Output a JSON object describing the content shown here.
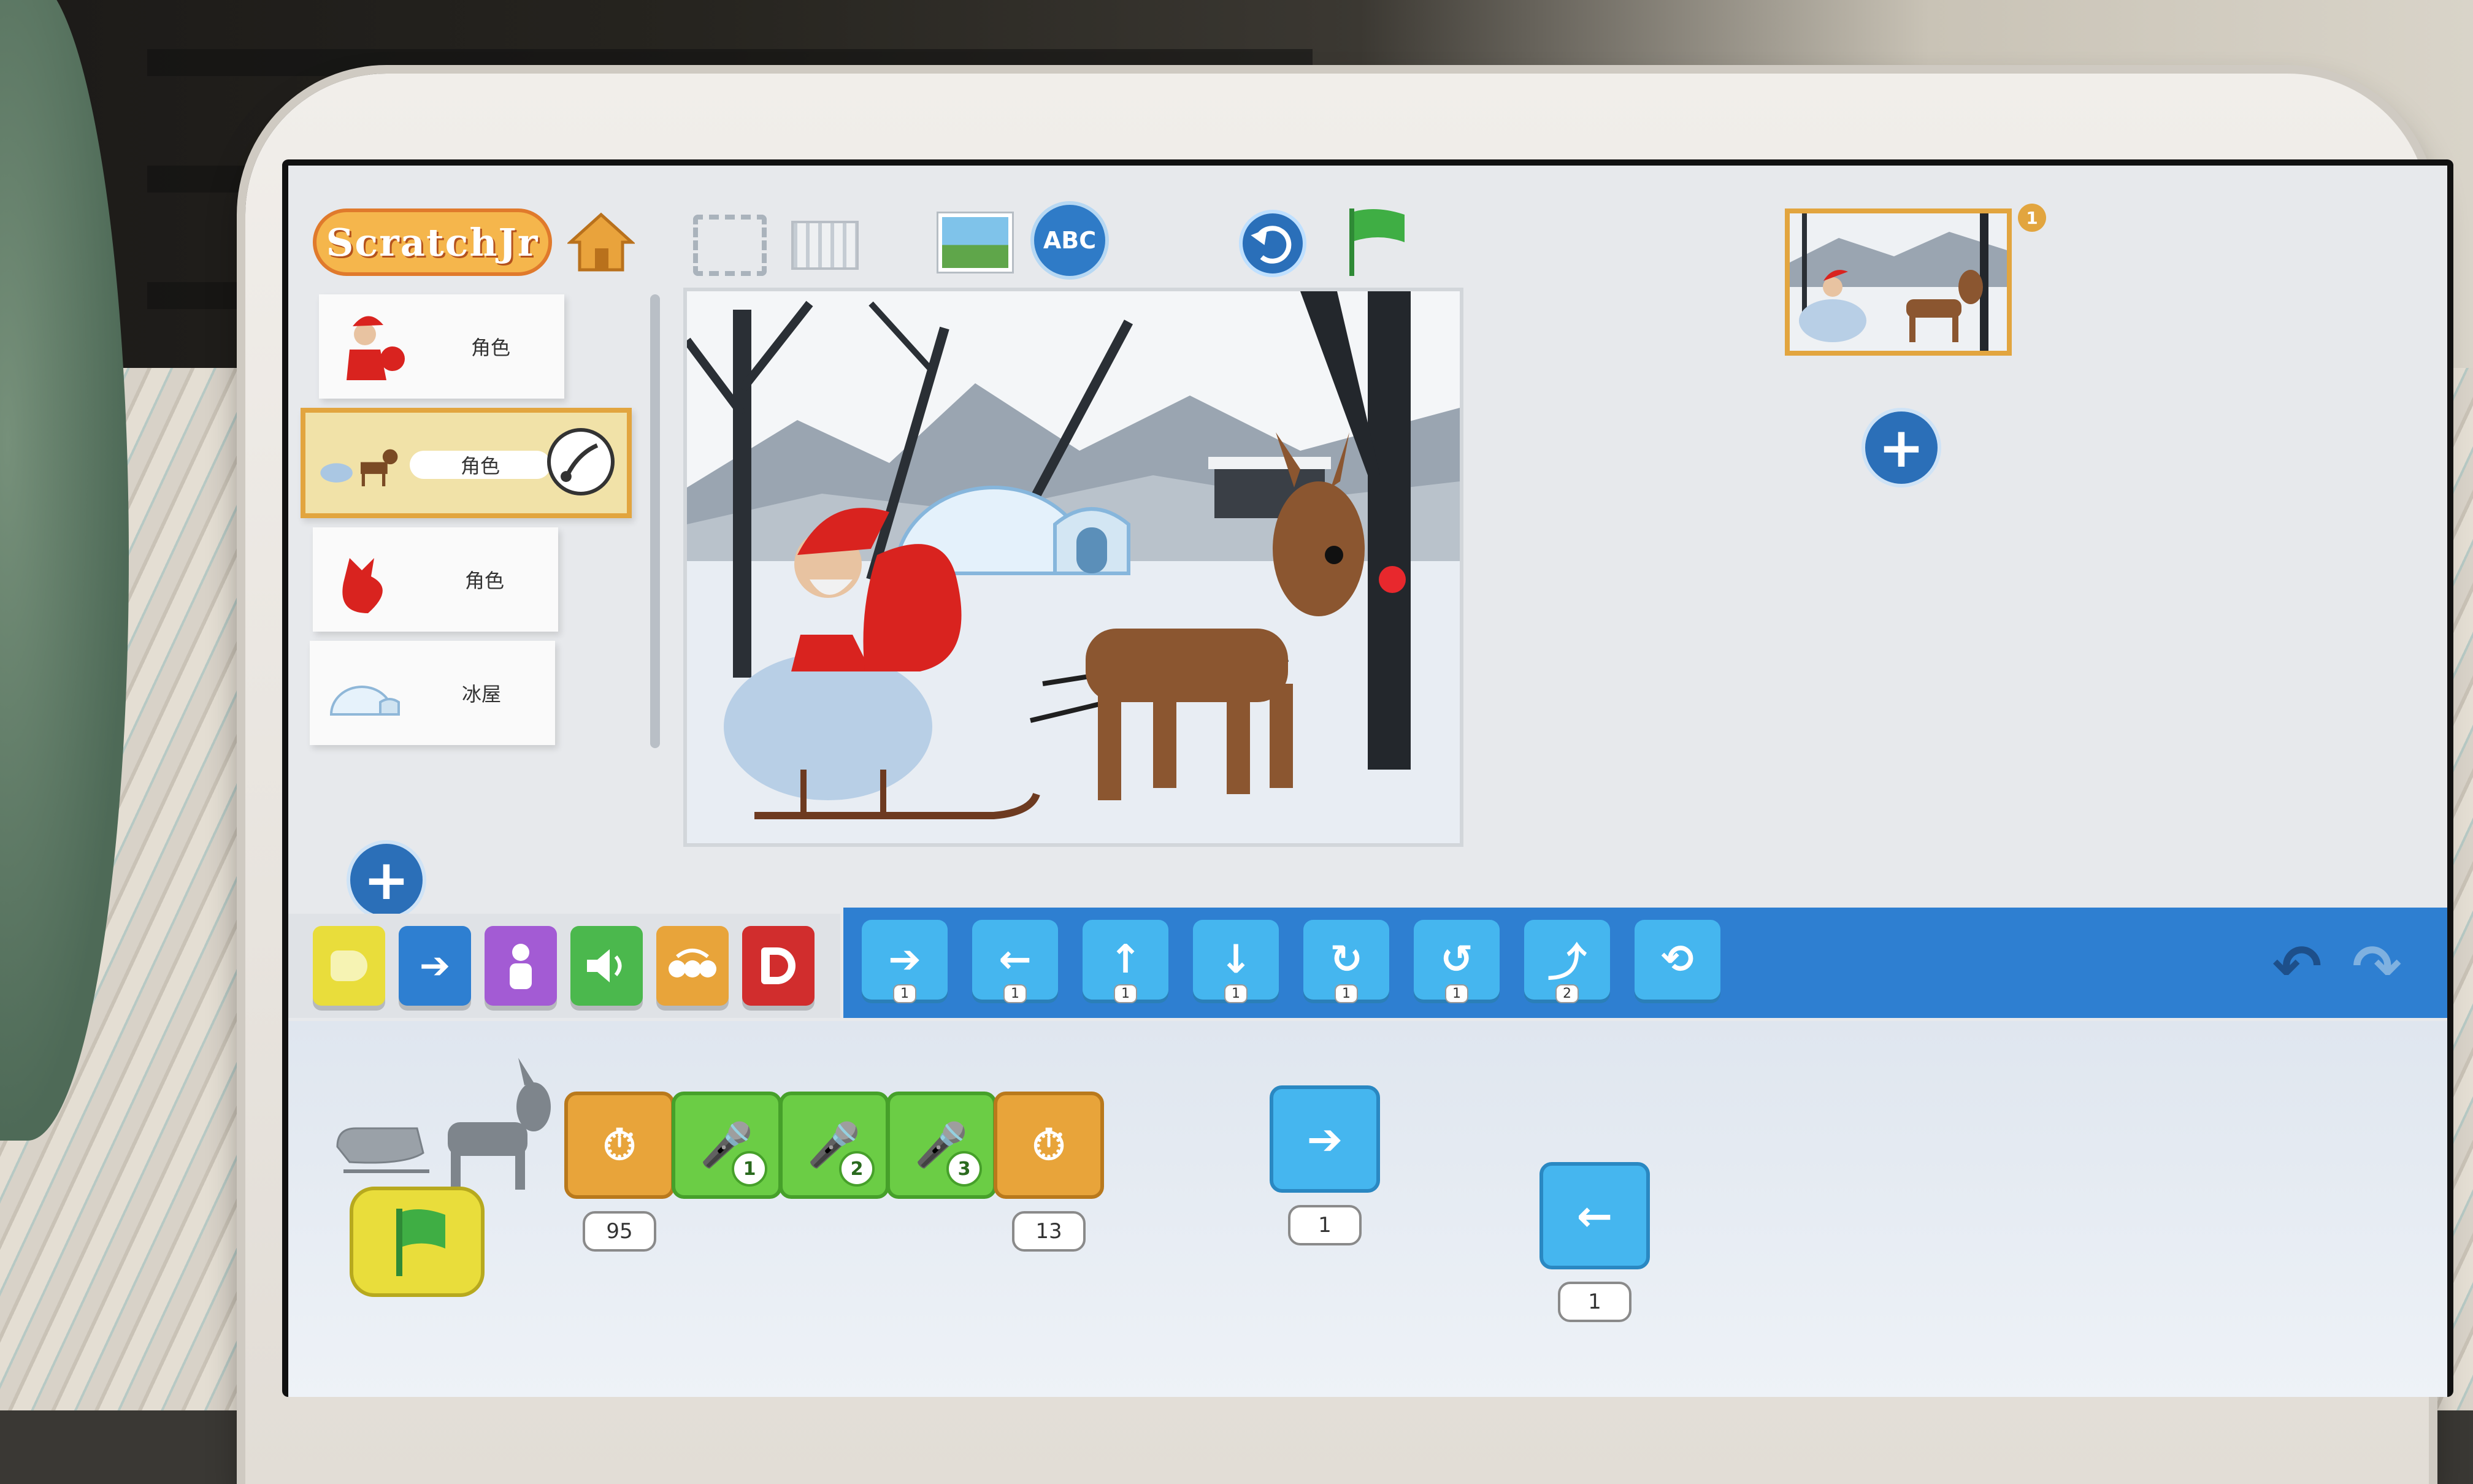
{
  "app": {
    "logo_text": "ScratchJr",
    "colors": {
      "accent": "#2e7fd1",
      "logo_orange": "#f5b64c",
      "selected": "#e2a53f"
    }
  },
  "toolbar": {
    "icons": [
      "home-icon",
      "fullscreen-icon",
      "grid-icon",
      "background-icon",
      "text-icon",
      "reset-icon",
      "green-flag-icon"
    ],
    "text_icon_label": "ABC"
  },
  "sprites": [
    {
      "name": "角色",
      "selected": false
    },
    {
      "name": "角色",
      "selected": true
    },
    {
      "name": "角色",
      "selected": false
    },
    {
      "name": "冰屋",
      "selected": false
    }
  ],
  "add_sprite_label": "+",
  "pages": {
    "current": "1",
    "add_label": "+"
  },
  "categories": [
    {
      "id": "triggering",
      "color": "#e9dd3b",
      "icon": "trigger-icon"
    },
    {
      "id": "motion",
      "color": "#2e7fd1",
      "icon": "arrow-right-icon",
      "glyph": "➔"
    },
    {
      "id": "looks",
      "color": "#a35bd4",
      "icon": "person-icon"
    },
    {
      "id": "sound",
      "color": "#4bb84d",
      "icon": "speaker-icon"
    },
    {
      "id": "control",
      "color": "#e8a43a",
      "icon": "control-icon"
    },
    {
      "id": "end",
      "color": "#d12d2d",
      "icon": "end-icon"
    }
  ],
  "palette_blocks": [
    {
      "name": "move-right",
      "glyph": "➔",
      "value": "1"
    },
    {
      "name": "move-left",
      "glyph": "←",
      "value": "1"
    },
    {
      "name": "move-up",
      "glyph": "↑",
      "value": "1"
    },
    {
      "name": "move-down",
      "glyph": "↓",
      "value": "1"
    },
    {
      "name": "turn-right",
      "glyph": "↻",
      "value": "1"
    },
    {
      "name": "turn-left",
      "glyph": "↺",
      "value": "1"
    },
    {
      "name": "hop",
      "glyph": "⤴",
      "value": "2"
    },
    {
      "name": "go-home",
      "glyph": "⟲",
      "value": ""
    }
  ],
  "undo_label": "↶",
  "redo_label": "↷",
  "script": {
    "blocks": [
      {
        "type": "wait",
        "glyph": "⏱",
        "param": "95"
      },
      {
        "type": "sound",
        "glyph": "🎤",
        "badge": "1"
      },
      {
        "type": "sound",
        "glyph": "🎤",
        "badge": "2"
      },
      {
        "type": "sound",
        "glyph": "🎤",
        "badge": "3"
      },
      {
        "type": "wait",
        "glyph": "⏱",
        "param": "13"
      }
    ],
    "loose_blocks": [
      {
        "type": "move-right",
        "glyph": "➔",
        "param": "1"
      },
      {
        "type": "move-left",
        "glyph": "←",
        "param": "1"
      }
    ]
  }
}
